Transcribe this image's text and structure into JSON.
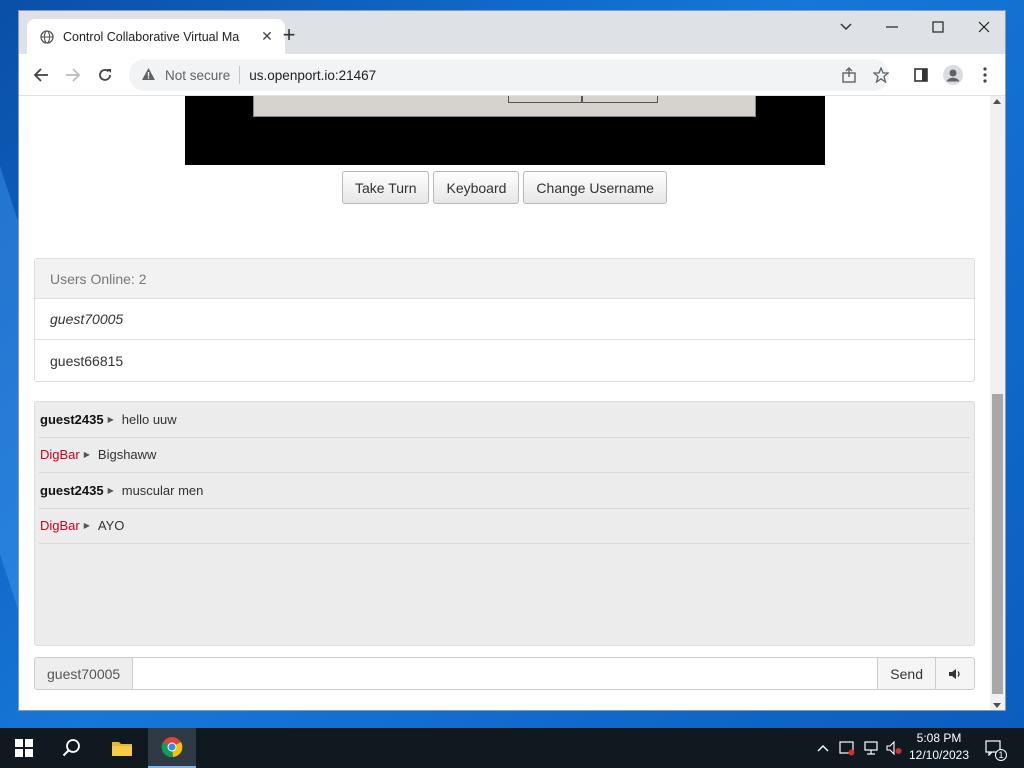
{
  "browser": {
    "tab_title": "Control Collaborative Virtual Ma",
    "security_label": "Not secure",
    "url": "us.openport.io:21467"
  },
  "controls": {
    "take_turn": "Take Turn",
    "keyboard": "Keyboard",
    "change_username": "Change Username"
  },
  "users": {
    "header": "Users Online: 2",
    "list": [
      "guest70005",
      "guest66815"
    ]
  },
  "chat": {
    "messages": [
      {
        "user": "guest2435",
        "text": "hello uuw",
        "highlight": false
      },
      {
        "user": "DigBar",
        "text": "Bigshaww",
        "highlight": true
      },
      {
        "user": "guest2435",
        "text": "muscular men",
        "highlight": false
      },
      {
        "user": "DigBar",
        "text": "AYO",
        "highlight": true
      }
    ],
    "username": "guest70005",
    "input_value": "",
    "send_label": "Send"
  },
  "taskbar": {
    "time": "5:08 PM",
    "date": "12/10/2023",
    "notification_count": "1"
  },
  "colors": {
    "highlight_user": "#d0021b",
    "desktop": "#0a64c8"
  }
}
